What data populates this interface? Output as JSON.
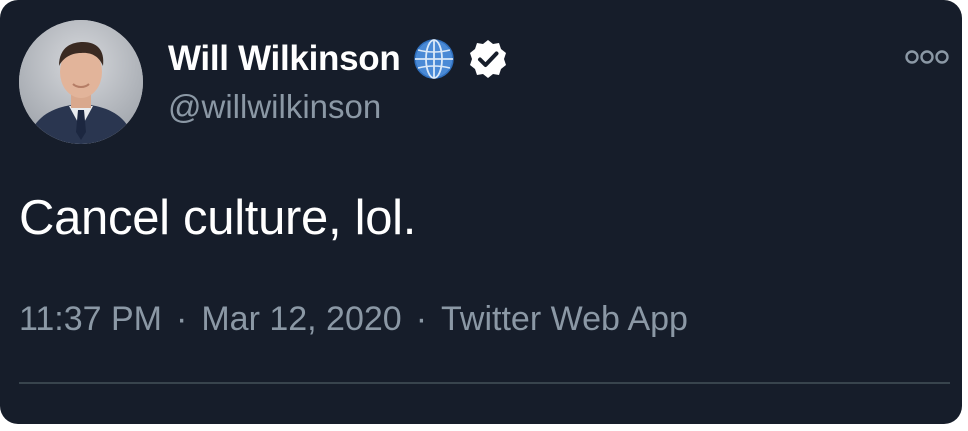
{
  "tweet": {
    "author": {
      "display_name": "Will Wilkinson",
      "handle": "@willwilkinson",
      "avatar_icon": "profile-photo",
      "badges": [
        "globe-icon",
        "verified-icon"
      ]
    },
    "text": "Cancel culture, lol.",
    "time": "11:37 PM",
    "separator": "·",
    "date": "Mar 12, 2020",
    "source": "Twitter Web App",
    "menu_icon": "more-options-icon"
  },
  "colors": {
    "background": "#161d2a",
    "primary_text": "#ffffff",
    "secondary_text": "#8b98a5",
    "divider": "#38444d",
    "globe_blue": "#4a8ad6"
  }
}
